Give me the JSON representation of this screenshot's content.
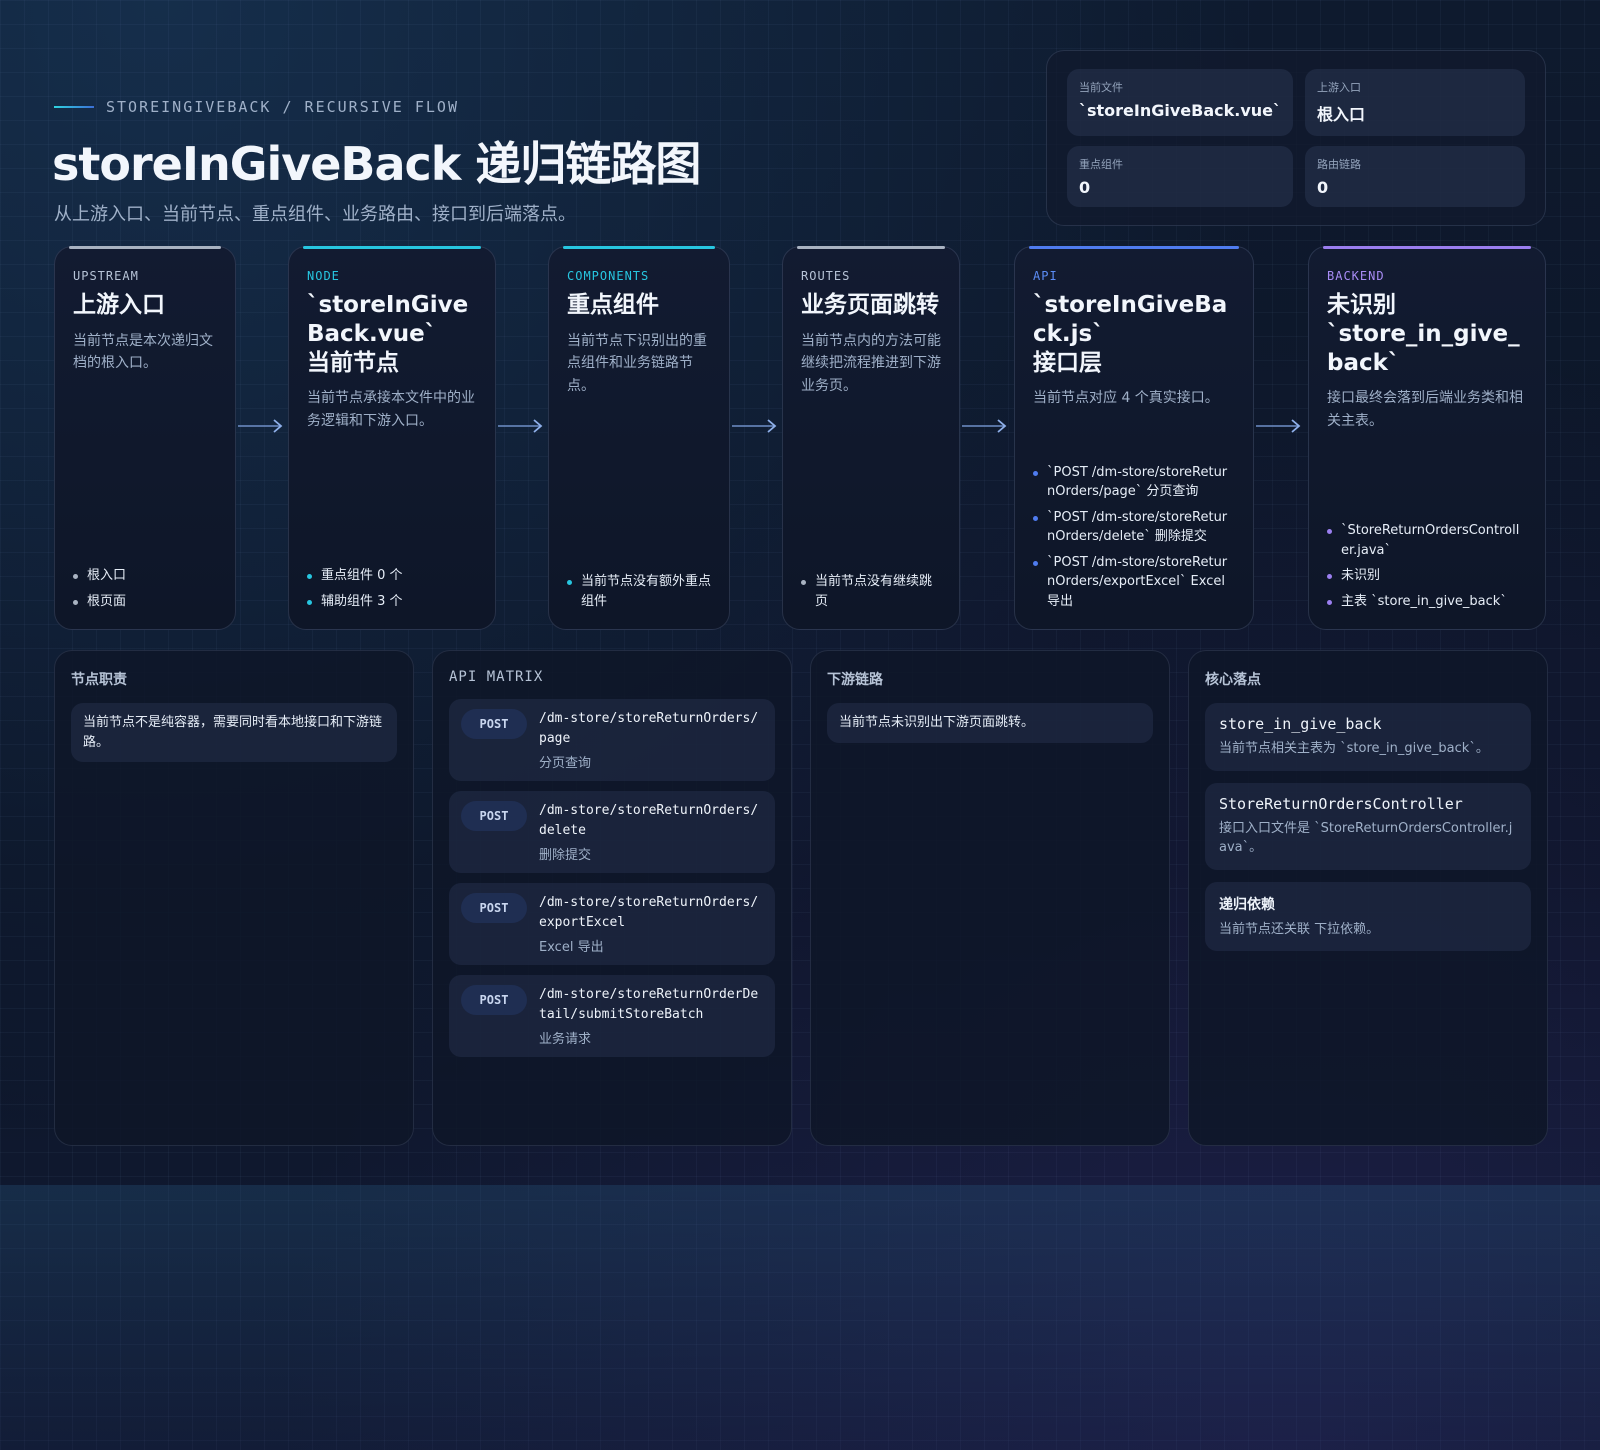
{
  "header": {
    "eyebrow": "STOREINGIVEBACK / RECURSIVE FLOW",
    "title": "storeInGiveBack 递归链路图",
    "subtitle": "从上游入口、当前节点、重点组件、业务路由、接口到后端落点。"
  },
  "stats": [
    {
      "label": "当前文件",
      "value": "`storeInGiveBack.vue`"
    },
    {
      "label": "上游入口",
      "value": "根入口"
    },
    {
      "label": "重点组件",
      "value": "0"
    },
    {
      "label": "路由链路",
      "value": "0"
    }
  ],
  "flow": [
    {
      "tag": "UPSTREAM",
      "head": "上游入口",
      "desc": "当前节点是本次递归文档的根入口。",
      "items": [
        "根入口",
        "根页面"
      ],
      "accent": "#a9b3c2"
    },
    {
      "tag": "NODE",
      "head": "`storeInGiveBack.vue`\n当前节点",
      "desc": "当前节点承接本文件中的业务逻辑和下游入口。",
      "items": [
        "重点组件 0 个",
        "辅助组件 3 个"
      ],
      "accent": "#27c6e0"
    },
    {
      "tag": "COMPONENTS",
      "head": "重点组件",
      "desc": "当前节点下识别出的重点组件和业务链路节点。",
      "items": [
        "当前节点没有额外重点组件"
      ],
      "accent": "#27c6e0"
    },
    {
      "tag": "ROUTES",
      "head": "业务页面跳转",
      "desc": "当前节点内的方法可能继续把流程推进到下游业务页。",
      "items": [
        "当前节点没有继续跳页"
      ],
      "accent": "#a9b3c2"
    },
    {
      "tag": "API",
      "head": "`storeInGiveBack.js`\n接口层",
      "desc": "当前节点对应 4 个真实接口。",
      "items": [
        "`POST /dm-store/storeReturnOrders/page` 分页查询",
        "`POST /dm-store/storeReturnOrders/delete` 删除提交",
        "`POST /dm-store/storeReturnOrders/exportExcel` Excel 导出"
      ],
      "accent": "#4f7cf0"
    },
    {
      "tag": "BACKEND",
      "head": "未识别\n`store_in_give_back`",
      "desc": "接口最终会落到后端业务类和相关主表。",
      "items": [
        "`StoreReturnOrdersController.java`",
        "未识别",
        "主表 `store_in_give_back`"
      ],
      "accent": "#9b7ff0"
    }
  ],
  "panels": {
    "duty": {
      "title": "节点职责",
      "note": "当前节点不是纯容器，需要同时看本地接口和下游链路。"
    },
    "api": {
      "title": "API MATRIX",
      "items": [
        {
          "method": "POST",
          "path": "/dm-store/storeReturnOrders/page",
          "label": "分页查询"
        },
        {
          "method": "POST",
          "path": "/dm-store/storeReturnOrders/delete",
          "label": "删除提交"
        },
        {
          "method": "POST",
          "path": "/dm-store/storeReturnOrders/exportExcel",
          "label": "Excel 导出"
        },
        {
          "method": "POST",
          "path": "/dm-store/storeReturnOrderDetail/submitStoreBatch",
          "label": "业务请求"
        }
      ]
    },
    "downstream": {
      "title": "下游链路",
      "note": "当前节点未识别出下游页面跳转。"
    },
    "landing": {
      "title": "核心落点",
      "items": [
        {
          "title": "store_in_give_back",
          "desc": "当前节点相关主表为 `store_in_give_back`。"
        },
        {
          "title": "StoreReturnOrdersController",
          "desc": "接口入口文件是 `StoreReturnOrdersController.java`。"
        },
        {
          "title": "递归依赖",
          "desc": "当前节点还关联 下拉依赖。"
        }
      ]
    }
  }
}
